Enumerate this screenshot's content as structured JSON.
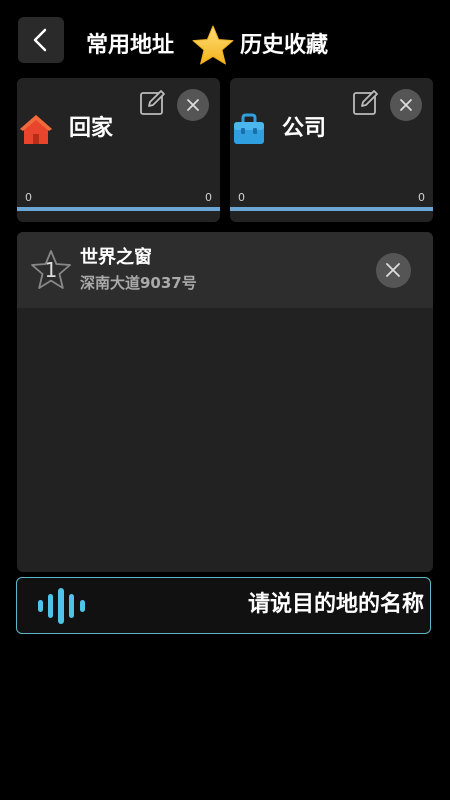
{
  "header": {
    "common_address": "常用地址",
    "history_favorites": "历史收藏"
  },
  "cards": [
    {
      "label": "回家",
      "icon": "home-icon",
      "progress_start": "0",
      "progress_end": "0"
    },
    {
      "label": "公司",
      "icon": "briefcase-icon",
      "progress_start": "0",
      "progress_end": "0"
    }
  ],
  "favorites": [
    {
      "index": "1",
      "name": "世界之窗",
      "address": "深南大道9037号"
    }
  ],
  "voice": {
    "prompt": "请说目的地的名称"
  },
  "colors": {
    "background": "#000000",
    "card": "#232323",
    "progress": "#6aa7d6",
    "voice_border": "#5fb6c8",
    "home_icon": "#e8452c",
    "briefcase_icon": "#2f9fe0",
    "star": "#f5c23a"
  }
}
